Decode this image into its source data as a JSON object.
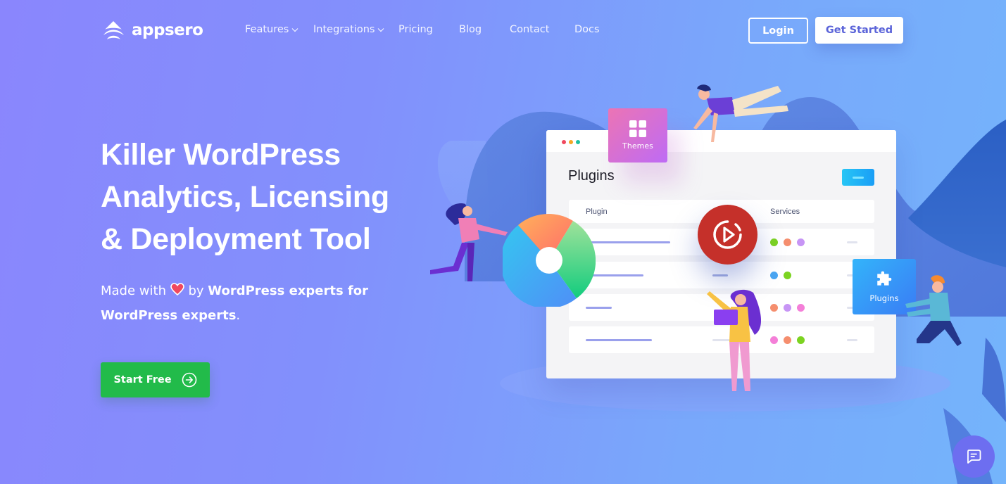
{
  "header": {
    "brand": "appsero",
    "nav": [
      {
        "label": "Features",
        "has_dropdown": true
      },
      {
        "label": "Integrations",
        "has_dropdown": true
      },
      {
        "label": "Pricing",
        "has_dropdown": false
      },
      {
        "label": "Blog",
        "has_dropdown": false
      },
      {
        "label": "Contact",
        "has_dropdown": false
      },
      {
        "label": "Docs",
        "has_dropdown": false
      }
    ],
    "login_label": "Login",
    "get_started_label": "Get Started"
  },
  "hero": {
    "title_line1": "Killer WordPress",
    "title_line2": "Analytics, Licensing",
    "title_line3": "& Deployment Tool",
    "subtitle_pre": "Made with",
    "subtitle_by": "by",
    "subtitle_bold1": "WordPress experts for",
    "subtitle_bold2": "WordPress experts",
    "subtitle_end": ".",
    "cta_label": "Start Free"
  },
  "illustration": {
    "window_title": "Plugins",
    "col_plugin": "Plugin",
    "col_services": "Services",
    "themes_card_label": "Themes",
    "plugins_card_label": "Plugins",
    "service_rows": [
      [
        "#7cd321",
        "#f58e6e",
        "#c795f5"
      ],
      [
        "#4aa6f2",
        "#7cd321"
      ],
      [
        "#f58e6e",
        "#c795f5",
        "#f47fd8"
      ],
      [
        "#f47fd8",
        "#f58e6e",
        "#7cd321"
      ]
    ]
  },
  "colors": {
    "primary_cta": "#22bb4a",
    "accent_text": "#5b64d9",
    "chat_button": "#6d6ef0"
  }
}
